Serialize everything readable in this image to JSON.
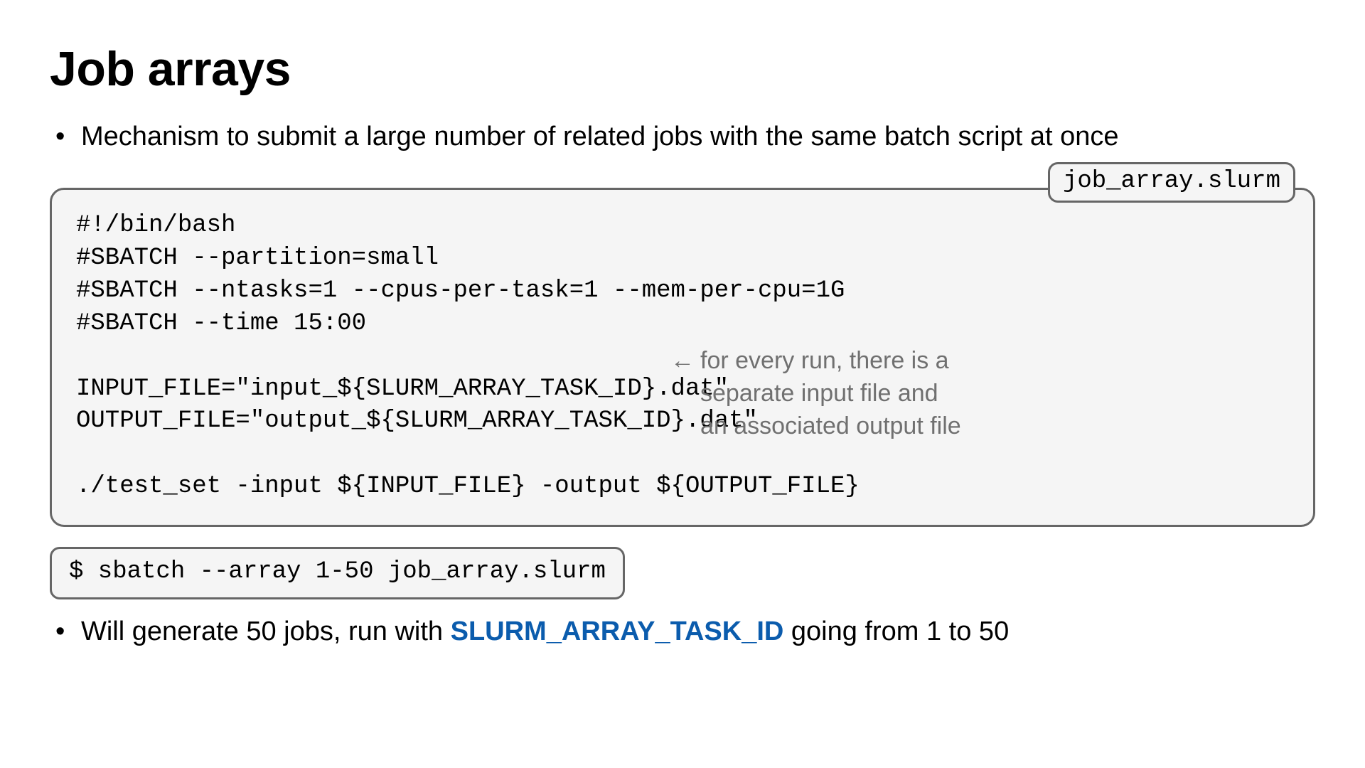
{
  "title": "Job arrays",
  "bullet_intro": "Mechanism to submit a large number of related jobs with the same batch script at once",
  "filename": "job_array.slurm",
  "script": {
    "l1": "#!/bin/bash",
    "l2": "#SBATCH --partition=small",
    "l3": "#SBATCH --ntasks=1 --cpus-per-task=1 --mem-per-cpu=1G",
    "l4": "#SBATCH --time 15:00",
    "l5": "",
    "l6": "INPUT_FILE=\"input_${SLURM_ARRAY_TASK_ID}.dat\"",
    "l7": "OUTPUT_FILE=\"output_${SLURM_ARRAY_TASK_ID}.dat\"",
    "l8": "",
    "l9": "./test_set -input ${INPUT_FILE} -output ${OUTPUT_FILE}"
  },
  "annotation": {
    "arrow": "←",
    "line1": "for every run, there is a",
    "line2": "separate input file and",
    "line3": "an associated output file"
  },
  "command": "$ sbatch --array 1-50 job_array.slurm",
  "bullet_result": {
    "pre": "Will generate 50 jobs, run with ",
    "env": "SLURM_ARRAY_TASK_ID",
    "post": " going from 1 to 50"
  }
}
